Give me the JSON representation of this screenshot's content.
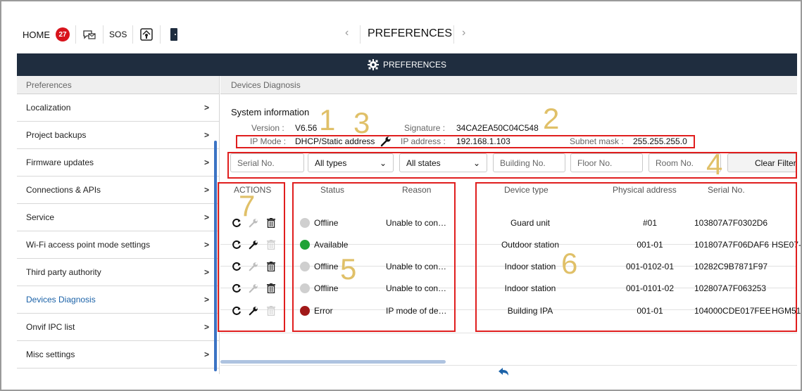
{
  "topbar": {
    "home_label": "HOME",
    "notification_count": "27",
    "sos_label": "SOS",
    "title": "PREFERENCES"
  },
  "header": {
    "title": "PREFERENCES"
  },
  "sidebar": {
    "header": "Preferences",
    "items": [
      {
        "label": "Localization"
      },
      {
        "label": "Project backups"
      },
      {
        "label": "Firmware updates"
      },
      {
        "label": "Connections & APIs"
      },
      {
        "label": "Service"
      },
      {
        "label": "Wi-Fi access point mode settings"
      },
      {
        "label": "Third party authority"
      },
      {
        "label": "Devices Diagnosis",
        "active": true
      },
      {
        "label": "Onvif IPC list"
      },
      {
        "label": "Misc settings"
      }
    ]
  },
  "main": {
    "header": "Devices Diagnosis",
    "system": {
      "title": "System information",
      "version_label": "Version :",
      "version": "V6.56",
      "signature_label": "Signature :",
      "signature": "34CA2EA50C04C548",
      "ip_mode_label": "IP Mode :",
      "ip_mode": "DHCP/Static address",
      "ip_address_label": "IP address :",
      "ip_address": "192.168.1.103",
      "subnet_label": "Subnet mask :",
      "subnet": "255.255.255.0"
    },
    "filters": {
      "serial_placeholder": "Serial No.",
      "type_value": "All types",
      "state_value": "All states",
      "building_placeholder": "Building No.",
      "floor_placeholder": "Floor No.",
      "room_placeholder": "Room No.",
      "clear_label": "Clear Filters"
    },
    "columns": {
      "actions": "ACTIONS",
      "status": "Status",
      "reason": "Reason",
      "device_type": "Device type",
      "physical_address": "Physical address",
      "serial": "Serial No."
    },
    "rows": [
      {
        "status": "Offline",
        "status_color": "#cfcfcf",
        "reason": "Unable to con…",
        "device_type": "Guard unit",
        "physical_address": "#01",
        "serial": "103807A7F0302D6",
        "extra": "",
        "config_enabled": false,
        "delete_enabled": true
      },
      {
        "status": "Available",
        "status_color": "#1fa336",
        "reason": "",
        "device_type": "Outdoor station",
        "physical_address": "001-01",
        "serial": "101807A7F06DAF6",
        "extra": "HSE07-",
        "config_enabled": true,
        "delete_enabled": false
      },
      {
        "status": "Offline",
        "status_color": "#cfcfcf",
        "reason": "Unable to con…",
        "device_type": "Indoor station",
        "physical_address": "001-0102-01",
        "serial": "10282C9B7871F97",
        "extra": "",
        "config_enabled": false,
        "delete_enabled": true
      },
      {
        "status": "Offline",
        "status_color": "#cfcfcf",
        "reason": "Unable to con…",
        "device_type": "Indoor station",
        "physical_address": "001-0101-02",
        "serial": "102807A7F063253",
        "extra": "",
        "config_enabled": false,
        "delete_enabled": true
      },
      {
        "status": "Error",
        "status_color": "#a11919",
        "reason": "IP mode of de…",
        "device_type": "Building IPA",
        "physical_address": "001-01",
        "serial": "104000CDE017FEE",
        "extra": "HGM51",
        "config_enabled": true,
        "delete_enabled": false
      }
    ]
  },
  "annotations": [
    "1",
    "2",
    "3",
    "4",
    "5",
    "6",
    "7"
  ],
  "colors": {
    "header_bg": "#1f2d3f",
    "accent": "#1b62a8",
    "highlight_box": "#e01e1e",
    "callout_number": "#e0c068"
  }
}
